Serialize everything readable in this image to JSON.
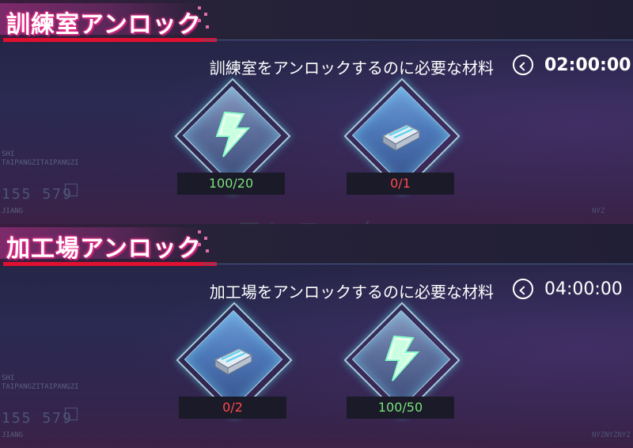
{
  "sections": [
    {
      "title": "訓練室アンロック",
      "subtitle": "訓練室をアンロックするのに必要な材料",
      "timer": "02:00:00",
      "materials": [
        {
          "icon": "lightning-crystal-icon",
          "count": "100/20",
          "status": "sufficient"
        },
        {
          "icon": "metal-ingot-icon",
          "count": "0/1",
          "status": "insufficient"
        }
      ]
    },
    {
      "title": "加工場アンロック",
      "subtitle": "加工場をアンロックするのに必要な材料",
      "timer": "04:00:00",
      "materials": [
        {
          "icon": "metal-ingot-icon",
          "count": "0/2",
          "status": "insufficient"
        },
        {
          "icon": "lightning-crystal-icon",
          "count": "100/50",
          "status": "sufficient"
        }
      ]
    }
  ],
  "background_text": {
    "left_labels": [
      "SHI",
      "TAIPANGZITAIPANGZI"
    ],
    "left_number": "155 579",
    "left_sub": "JIANG",
    "right_labels": [
      "NYZ",
      "NYZNYZNYZ"
    ],
    "ghost_banner": "アンロック"
  },
  "colors": {
    "count_sufficient": "#7be27b",
    "count_insufficient": "#ff4a4a",
    "title_glow": "#ff3a9a",
    "underline": "#e01030"
  }
}
